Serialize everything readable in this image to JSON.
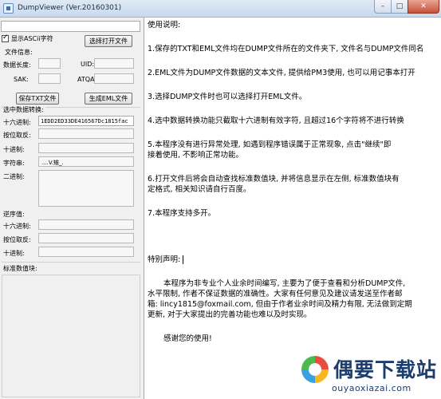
{
  "window": {
    "title": "DumpViewer (Ver.20160301)",
    "minimize_glyph": "–",
    "maximize_glyph": "□",
    "close_glyph": "✕"
  },
  "left": {
    "path_value": "",
    "show_ascii_label": "显示ASCii字符",
    "show_ascii_checked": true,
    "select_file_button": "选择打开文件",
    "file_info_title": "文件信息:",
    "data_length_label": "数据长度:",
    "uid_label": "UID:",
    "sak_label": "SAK:",
    "atqa_label": "ATQA:",
    "save_txt_button": "保存TXT文件",
    "gen_eml_button": "生成EML文件",
    "selection_title": "选中数据转换:",
    "hex_label": "十六进制:",
    "hex_value": "1EDD2ED33DE416567Dc1815fac",
    "bitwise_label": "按位取反:",
    "decimal_label": "十进制:",
    "string_label": "字符串:",
    "string_value": "....V.雉_.",
    "binary_label": "二进制:",
    "reverse_title": "逆序值:",
    "rev_hex_label": "十六进制:",
    "rev_bitwise_label": "按位取反:",
    "rev_decimal_label": "十进制:",
    "std_value_title": "标准数值块:"
  },
  "doc": {
    "heading": "使用说明:",
    "p1": "1.保存的TXT和EML文件均在DUMP文件所在的文件夹下, 文件名与DUMP文件同名",
    "p2": "2.EML文件为DUMP文件数据的文本文件, 提供给PM3使用, 也可以用记事本打开",
    "p3": "3.选择DUMP文件时也可以选择打开EML文件。",
    "p4": "4.选中数据转换功能只截取十六进制有效字符, 且超过16个字符将不进行转换",
    "p5a": "5.本程序没有进行异常处理, 如遇到程序错误属于正常现象, 点击\"继续\"即",
    "p5b": "接着使用, 不影响正常功能。",
    "p6a": "6.打开文件后将会自动查找标准数值块, 并将信息显示在左侧, 标准数值块有",
    "p6b": "定格式, 相关知识请自行百度。",
    "p7": "7.本程序支持多开。",
    "disclaimer_title": "特别声明:",
    "d1": "本程序为非专业个人业余时间编写, 主要为了便于查看和分析DUMP文件,",
    "d2": "水平限制, 作者不保证数据的准确性。大家有任何意见及建议请发送至作者邮",
    "d3": "箱: lincy1815@foxmail.com, 但由于作者业余时间及精力有限, 无法做到定期",
    "d4": "更新, 对于大家提出的完善功能也难以及时实现。",
    "thanks": "感谢您的使用!"
  },
  "watermark": {
    "title": "偶要下载站",
    "url": "ouyaoxiazai.com"
  }
}
